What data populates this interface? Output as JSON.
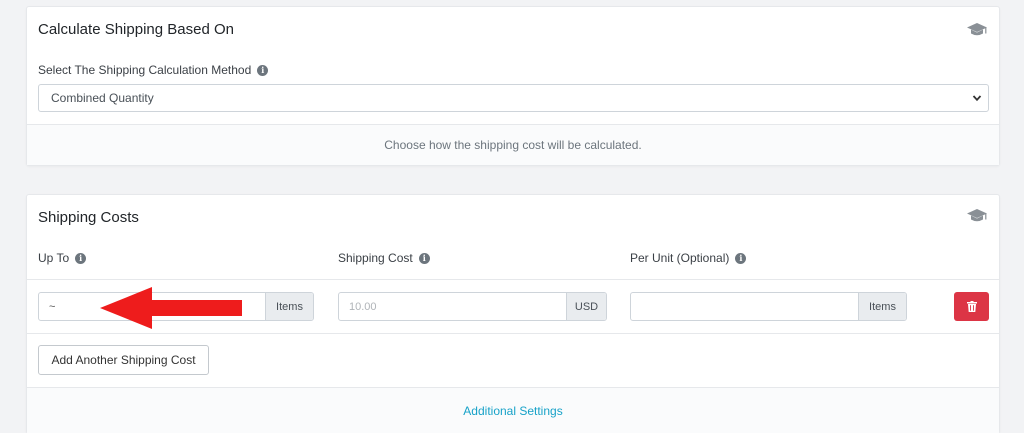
{
  "calc_card": {
    "title": "Calculate Shipping Based On",
    "method_label": "Select The Shipping Calculation Method",
    "method_value": "Combined Quantity",
    "help_text": "Choose how the shipping cost will be calculated."
  },
  "costs_card": {
    "title": "Shipping Costs",
    "columns": {
      "up_to": "Up To",
      "shipping_cost": "Shipping Cost",
      "per_unit": "Per Unit (Optional)"
    },
    "row": {
      "up_to_value": "~",
      "up_to_addon": "Items",
      "shipping_cost_placeholder": "10.00",
      "shipping_cost_addon": "USD",
      "per_unit_value": "",
      "per_unit_addon": "Items"
    },
    "add_button_label": "Add Another Shipping Cost",
    "additional_settings_link": "Additional Settings"
  },
  "icons": {
    "card_header": "graduation-cap-icon",
    "info": "info-circle-icon",
    "delete": "trash-icon",
    "select_caret": "chevron-down-icon",
    "annotation": "red-arrow-icon"
  },
  "colors": {
    "danger": "#dc3545",
    "link": "#17a2c8",
    "annotation_arrow": "#ee1c1c"
  }
}
